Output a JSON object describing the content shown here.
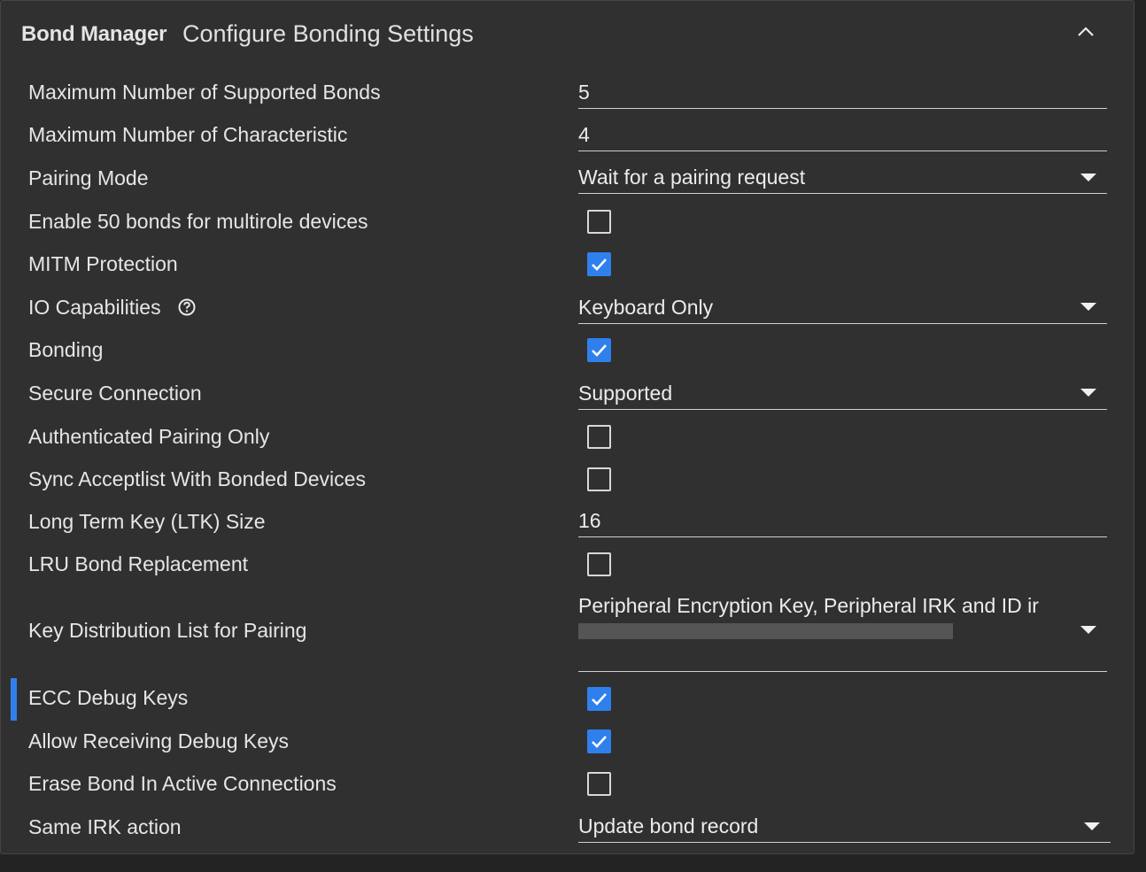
{
  "header": {
    "title": "Bond Manager",
    "subtitle": "Configure Bonding Settings",
    "collapse_icon": "chevron-up-icon"
  },
  "settings": {
    "max_bonds": {
      "label": "Maximum Number of Supported Bonds",
      "value": "5"
    },
    "max_characteristic": {
      "label": "Maximum Number of Characteristic",
      "value": "4"
    },
    "pairing_mode": {
      "label": "Pairing Mode",
      "value": "Wait for a pairing request"
    },
    "enable_50_bonds": {
      "label": "Enable 50 bonds for multirole devices",
      "checked": false
    },
    "mitm_protection": {
      "label": "MITM Protection",
      "checked": true
    },
    "io_capabilities": {
      "label": "IO Capabilities",
      "value": "Keyboard Only",
      "help_icon": "question-circle-icon"
    },
    "bonding": {
      "label": "Bonding",
      "checked": true
    },
    "secure_connection": {
      "label": "Secure Connection",
      "value": "Supported"
    },
    "authenticated_pairing_only": {
      "label": "Authenticated Pairing Only",
      "checked": false
    },
    "sync_acceptlist": {
      "label": "Sync Acceptlist With Bonded Devices",
      "checked": false
    },
    "ltk_size": {
      "label": "Long Term Key (LTK) Size",
      "value": "16"
    },
    "lru_bond_replacement": {
      "label": "LRU Bond Replacement",
      "checked": false
    },
    "key_distribution": {
      "label": "Key Distribution List for Pairing",
      "value": "Peripheral Encryption Key, Peripheral IRK and ID ir"
    },
    "ecc_debug_keys": {
      "label": "ECC Debug Keys",
      "checked": true
    },
    "allow_receiving_debug_keys": {
      "label": "Allow Receiving Debug Keys",
      "checked": true
    },
    "erase_bond_active": {
      "label": "Erase Bond In Active Connections",
      "checked": false
    },
    "same_irk_action": {
      "label": "Same IRK action",
      "value": "Update bond record"
    }
  },
  "colors": {
    "accent": "#2f80ed",
    "panel_bg": "#303030",
    "page_bg": "#232323",
    "text": "#e6e6e6"
  }
}
